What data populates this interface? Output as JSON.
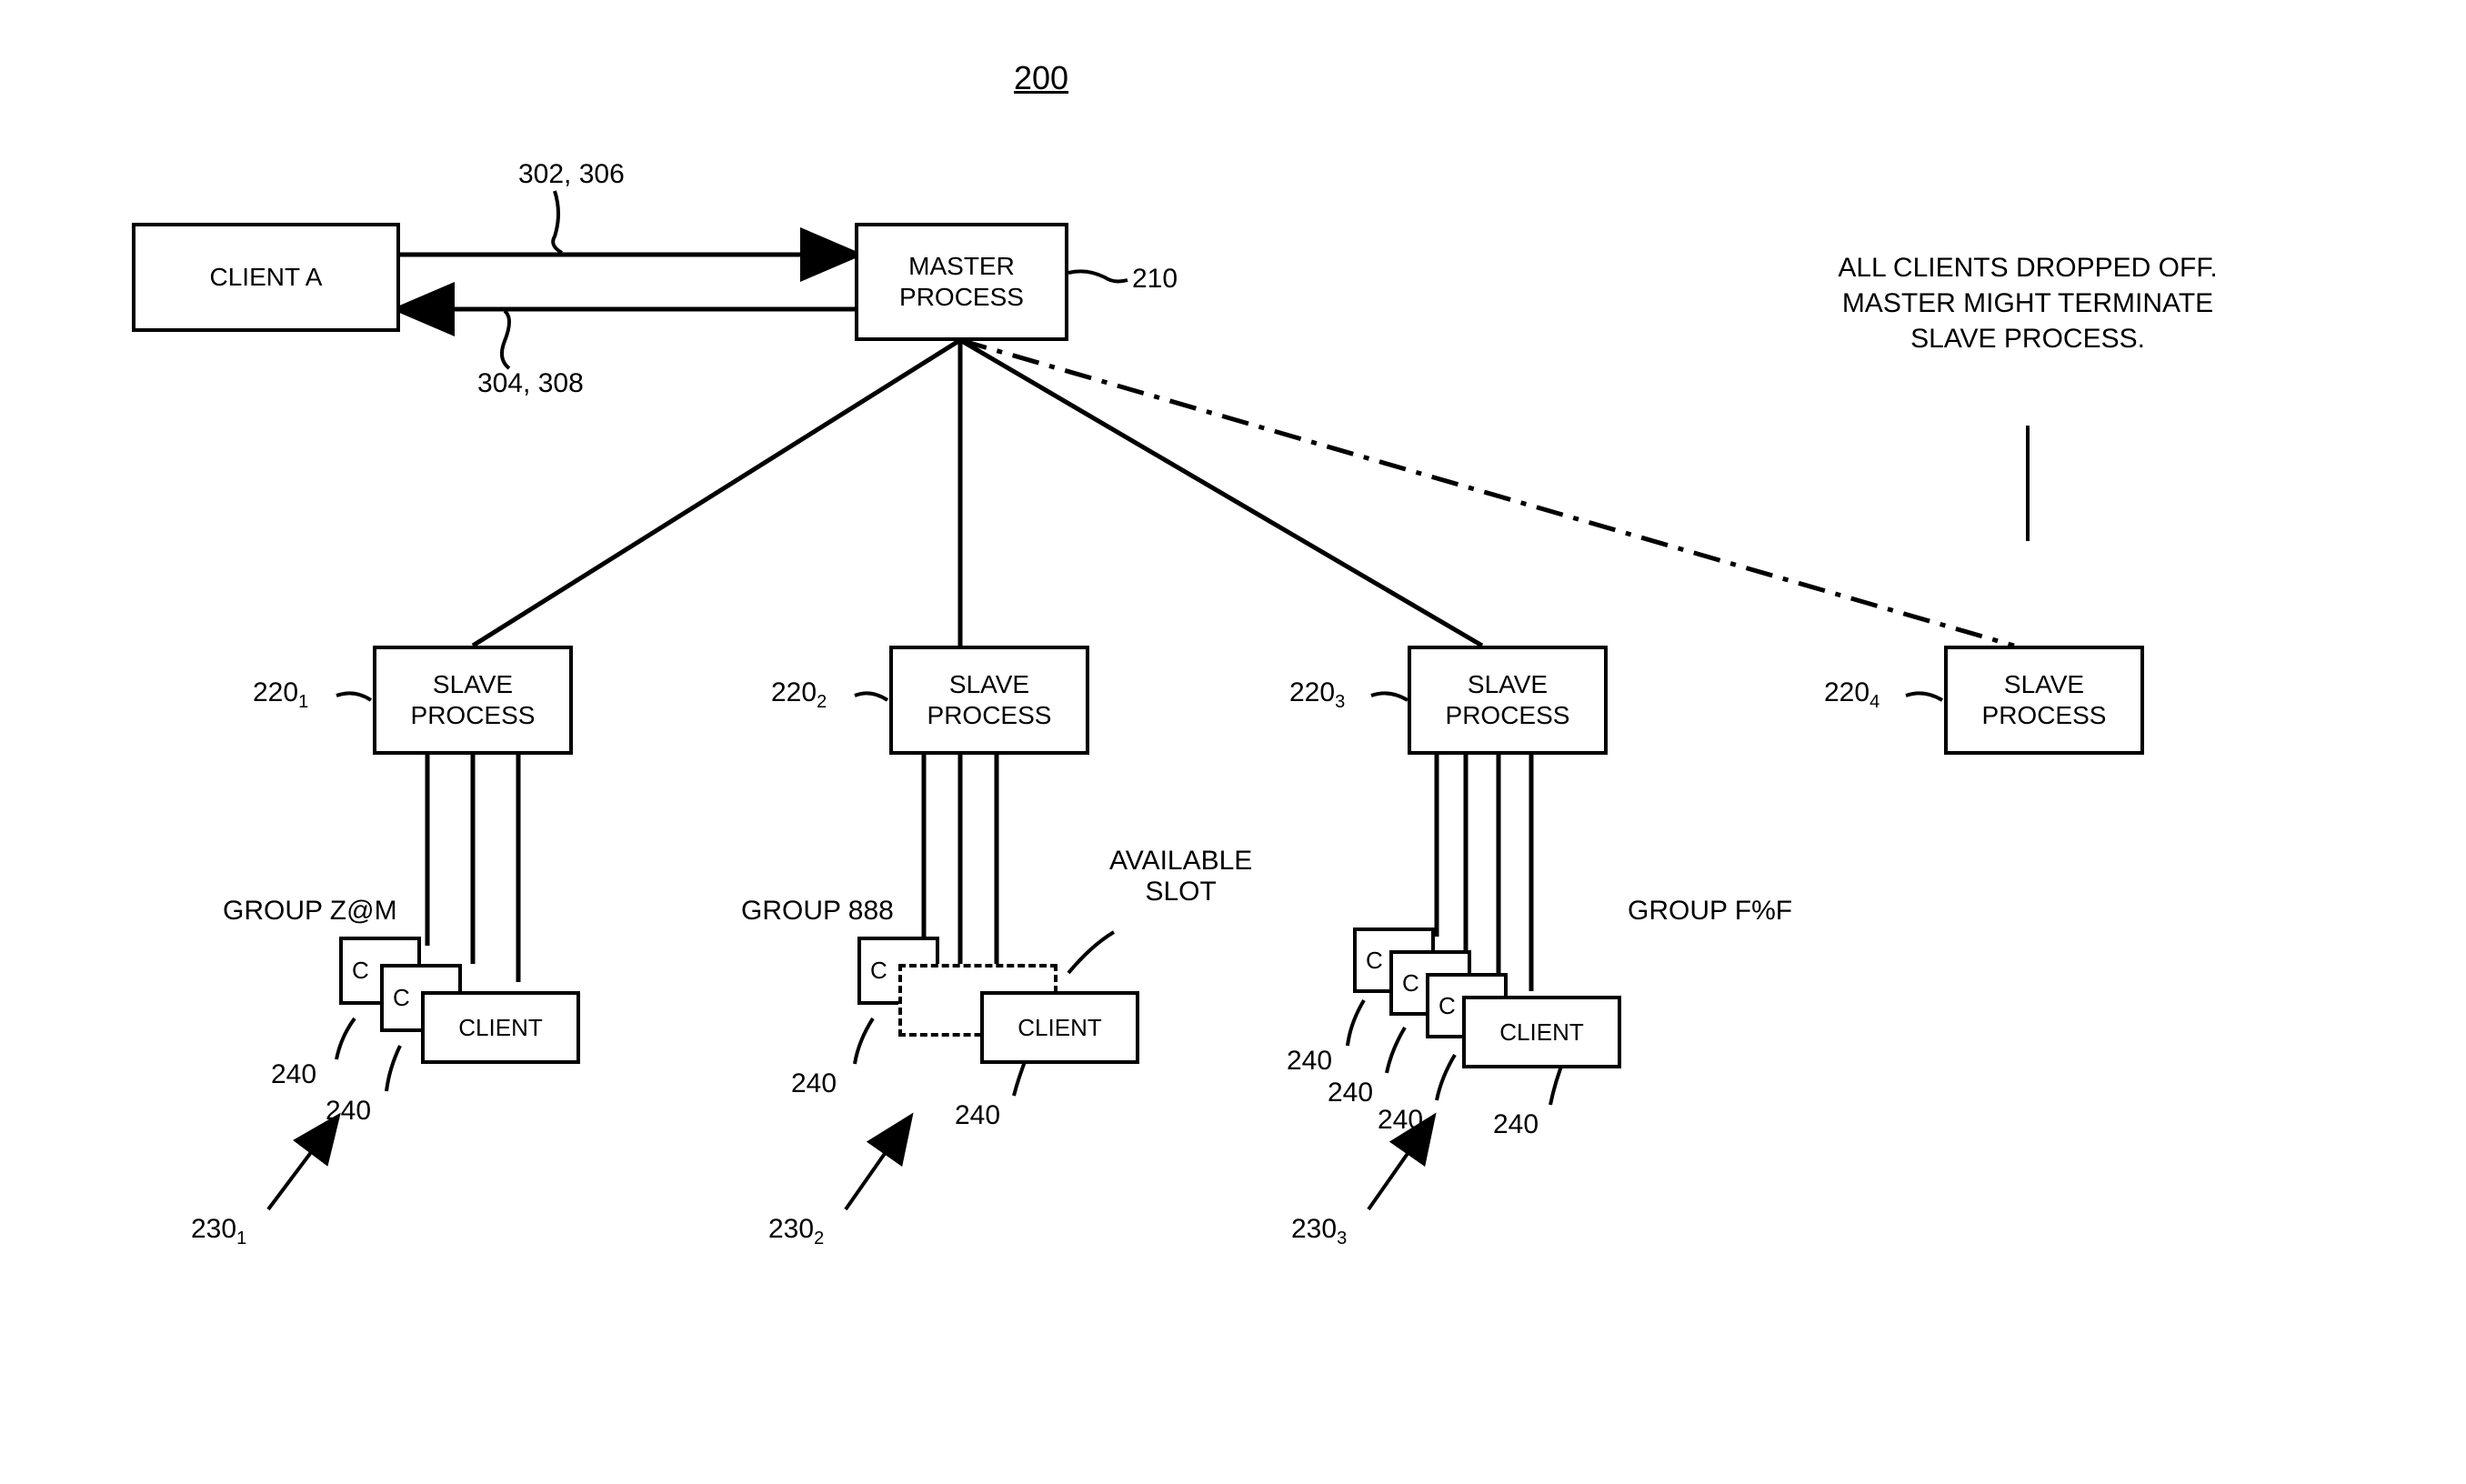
{
  "figure_number": "200",
  "client_a": {
    "label": "CLIENT A"
  },
  "master": {
    "label": "MASTER\nPROCESS",
    "ref": "210"
  },
  "arrows": {
    "top_label": "302, 306",
    "bottom_label": "304, 308"
  },
  "note": {
    "text": "ALL CLIENTS DROPPED OFF.\nMASTER MIGHT TERMINATE\nSLAVE PROCESS."
  },
  "slaves": [
    {
      "label": "SLAVE\nPROCESS",
      "ref": "220",
      "sub": "1"
    },
    {
      "label": "SLAVE\nPROCESS",
      "ref": "220",
      "sub": "2"
    },
    {
      "label": "SLAVE\nPROCESS",
      "ref": "220",
      "sub": "3"
    },
    {
      "label": "SLAVE\nPROCESS",
      "ref": "220",
      "sub": "4"
    }
  ],
  "groups": [
    {
      "name": "GROUP Z@M",
      "ref": "230",
      "sub": "1",
      "clients": [
        {
          "ref": "240"
        },
        {
          "ref": "240"
        },
        {
          "label": "CLIENT"
        }
      ]
    },
    {
      "name": "GROUP 888",
      "ref": "230",
      "sub": "2",
      "available_slot_label": "AVAILABLE\nSLOT",
      "clients": [
        {
          "ref": "240"
        },
        {
          "dashed": true
        },
        {
          "ref": "240",
          "label": "CLIENT"
        }
      ]
    },
    {
      "name": "GROUP F%F",
      "ref": "230",
      "sub": "3",
      "clients": [
        {
          "ref": "240"
        },
        {
          "ref": "240"
        },
        {
          "ref": "240"
        },
        {
          "ref": "240",
          "label": "CLIENT"
        }
      ]
    }
  ],
  "client_label_generic": "CLIENT",
  "client_ref_generic": "240",
  "client_partial": "C"
}
